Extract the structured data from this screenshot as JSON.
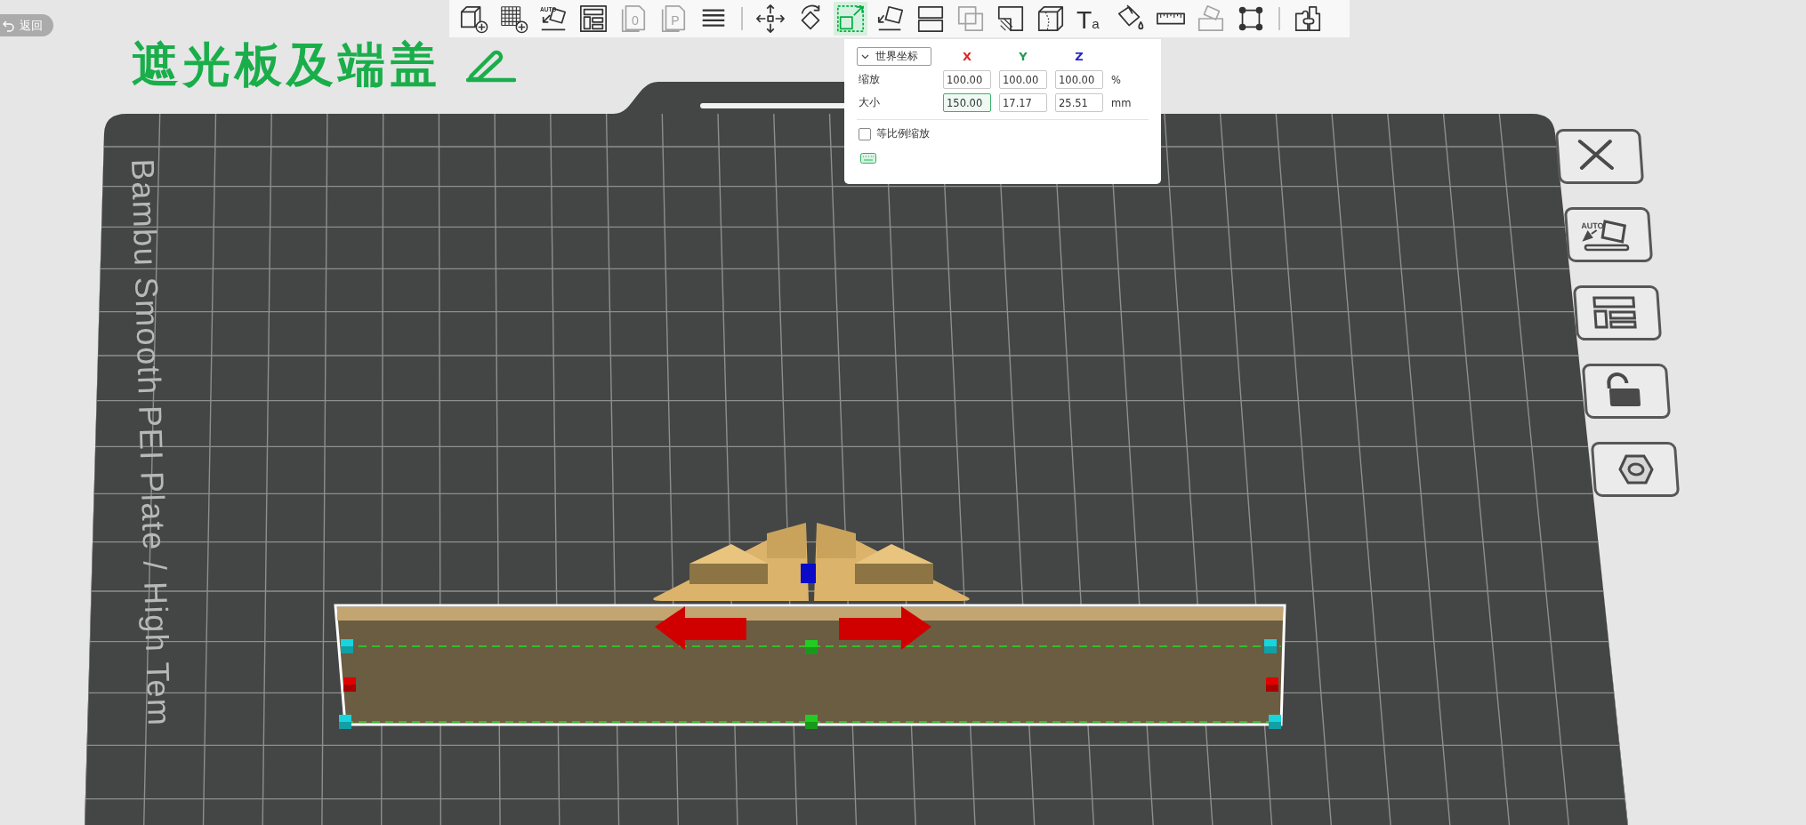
{
  "back_button": {
    "label": "返回"
  },
  "project_title": {
    "text": "遮光板及端盖"
  },
  "toolbar": {
    "groups": [
      [
        {
          "kind": "add-cube",
          "selected": false,
          "disabled": false
        },
        {
          "kind": "add-plate",
          "selected": false,
          "disabled": false
        },
        {
          "kind": "auto-orient",
          "glyph": "AUTO",
          "selected": false,
          "disabled": false
        },
        {
          "kind": "arrange",
          "selected": false,
          "disabled": false
        },
        {
          "kind": "copy",
          "glyph": "0",
          "selected": false,
          "disabled": true
        },
        {
          "kind": "copy",
          "glyph": "P",
          "selected": false,
          "disabled": true
        },
        {
          "kind": "layers",
          "selected": false,
          "disabled": false
        }
      ],
      [
        {
          "kind": "move",
          "selected": false,
          "disabled": false
        },
        {
          "kind": "rotate",
          "selected": false,
          "disabled": false
        },
        {
          "kind": "scale",
          "selected": true,
          "disabled": false
        },
        {
          "kind": "lay-on-face",
          "selected": false,
          "disabled": false
        },
        {
          "kind": "split",
          "selected": false,
          "disabled": false
        },
        {
          "kind": "boolean",
          "selected": false,
          "disabled": true
        },
        {
          "kind": "cut",
          "selected": false,
          "disabled": false
        },
        {
          "kind": "seam",
          "selected": false,
          "disabled": false
        },
        {
          "kind": "text",
          "glyph": "Ta",
          "selected": false,
          "disabled": false
        },
        {
          "kind": "paint",
          "selected": false,
          "disabled": false
        },
        {
          "kind": "measure",
          "selected": false,
          "disabled": false
        },
        {
          "kind": "assembly",
          "selected": false,
          "disabled": true
        },
        {
          "kind": "frame",
          "selected": false,
          "disabled": false
        }
      ],
      [
        {
          "kind": "puzzle",
          "selected": false,
          "disabled": false
        }
      ]
    ]
  },
  "scale_panel": {
    "coordinate_system": "世界坐标",
    "axes": [
      {
        "label": "X",
        "color": "#e02424"
      },
      {
        "label": "Y",
        "color": "#1f9e4a"
      },
      {
        "label": "Z",
        "color": "#2828c8"
      }
    ],
    "rows": [
      {
        "label": "缩放",
        "values": [
          {
            "value": "100.00",
            "focused": false
          },
          {
            "value": "100.00",
            "focused": false
          },
          {
            "value": "100.00",
            "focused": false
          }
        ],
        "unit": "%"
      },
      {
        "label": "大小",
        "values": [
          {
            "value": "150.00",
            "focused": true
          },
          {
            "value": "17.17",
            "focused": false
          },
          {
            "value": "25.51",
            "focused": false
          }
        ],
        "unit": "mm"
      }
    ],
    "uniform_scale": {
      "label": "等比例缩放",
      "checked": false
    }
  },
  "side_tools": [
    {
      "kind": "close"
    },
    {
      "kind": "auto-orient",
      "glyph": "AUTO"
    },
    {
      "kind": "arrange"
    },
    {
      "kind": "lock",
      "locked": false
    },
    {
      "kind": "plate-settings"
    }
  ],
  "plate": {
    "label": "Bambu Smooth PEI Plate / High Tem"
  }
}
